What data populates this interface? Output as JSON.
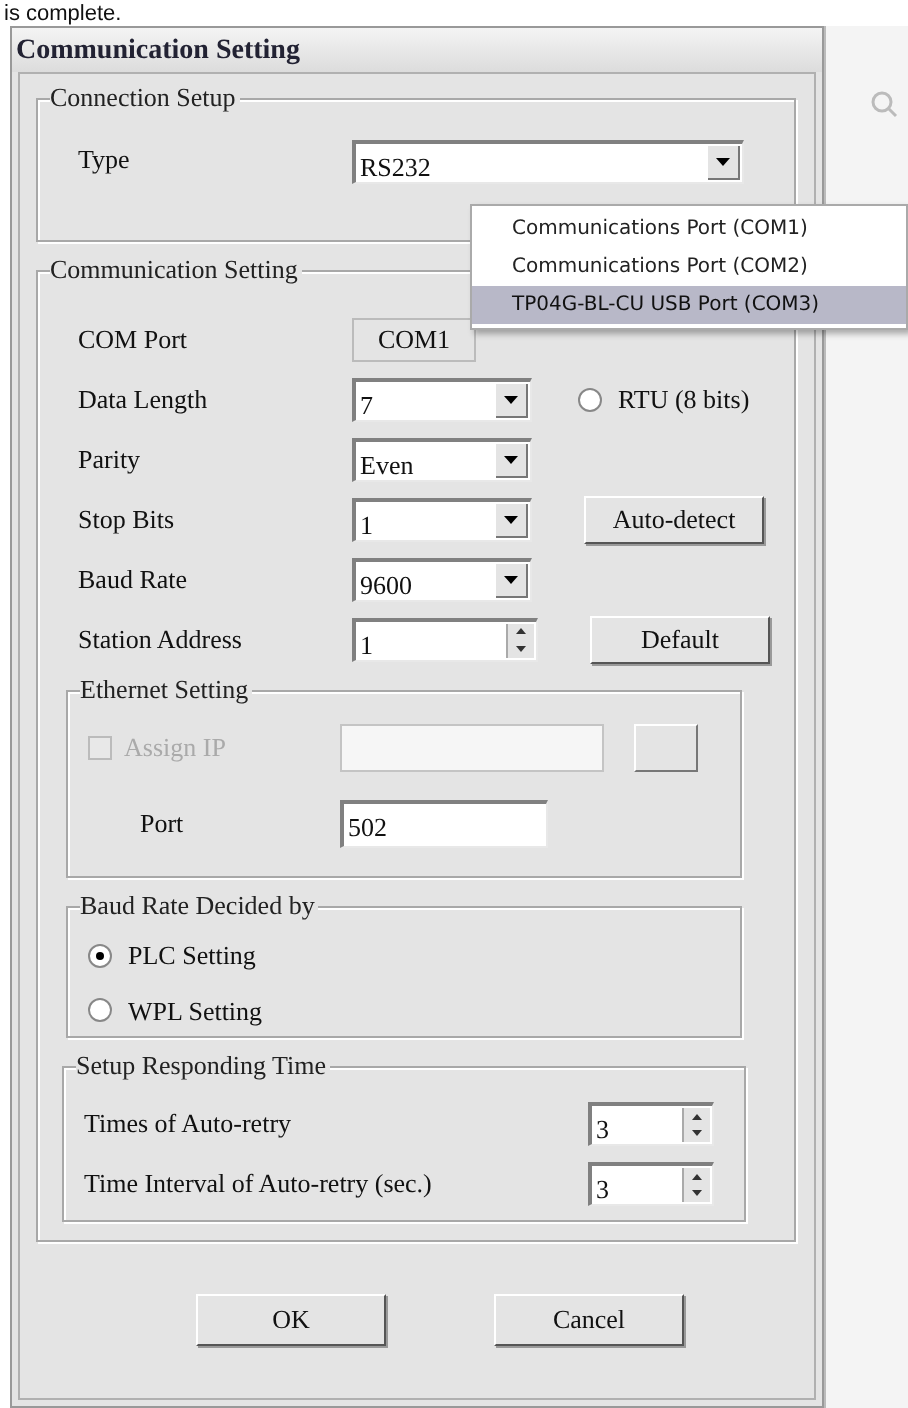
{
  "caption": "is complete.",
  "window": {
    "title": "Communication Setting"
  },
  "connection_setup": {
    "title": "Connection Setup",
    "type": {
      "label": "Type",
      "value": "RS232"
    }
  },
  "port_dropdown": {
    "options": [
      {
        "label": "Communications Port (COM1)",
        "selected": false
      },
      {
        "label": "Communications Port (COM2)",
        "selected": false
      },
      {
        "label": "TP04G-BL-CU USB Port (COM3)",
        "selected": true
      }
    ]
  },
  "communication_setting": {
    "title": "Communication Setting",
    "fields": [
      {
        "kind": "static",
        "label": "COM Port",
        "value": "COM1"
      },
      {
        "kind": "combo",
        "label": "Data Length",
        "value": "7",
        "side": {
          "kind": "radio",
          "label": "RTU (8 bits)",
          "selected": false
        }
      },
      {
        "kind": "combo",
        "label": "Parity",
        "value": "Even"
      },
      {
        "kind": "combo",
        "label": "Stop Bits",
        "value": "1",
        "side": {
          "kind": "button",
          "label": "Auto-detect"
        }
      },
      {
        "kind": "combo",
        "label": "Baud Rate",
        "value": "9600"
      },
      {
        "kind": "spin",
        "label": "Station Address",
        "value": "1",
        "side": {
          "kind": "button",
          "label": "Default"
        }
      }
    ],
    "ethernet": {
      "title": "Ethernet Setting",
      "assign_ip": {
        "label": "Assign IP",
        "checked": false,
        "disabled": true
      },
      "port": {
        "label": "Port",
        "value": "502"
      }
    },
    "baud_rate_decided_by": {
      "title": "Baud Rate Decided by",
      "options": [
        {
          "label": "PLC Setting",
          "selected": true
        },
        {
          "label": "WPL Setting",
          "selected": false
        }
      ]
    },
    "responding_time": {
      "title": "Setup Responding Time",
      "fields": [
        {
          "label": "Times of Auto-retry",
          "value": "3"
        },
        {
          "label": "Time Interval of Auto-retry (sec.)",
          "value": "3"
        }
      ]
    }
  },
  "buttons": [
    "OK",
    "Cancel"
  ]
}
